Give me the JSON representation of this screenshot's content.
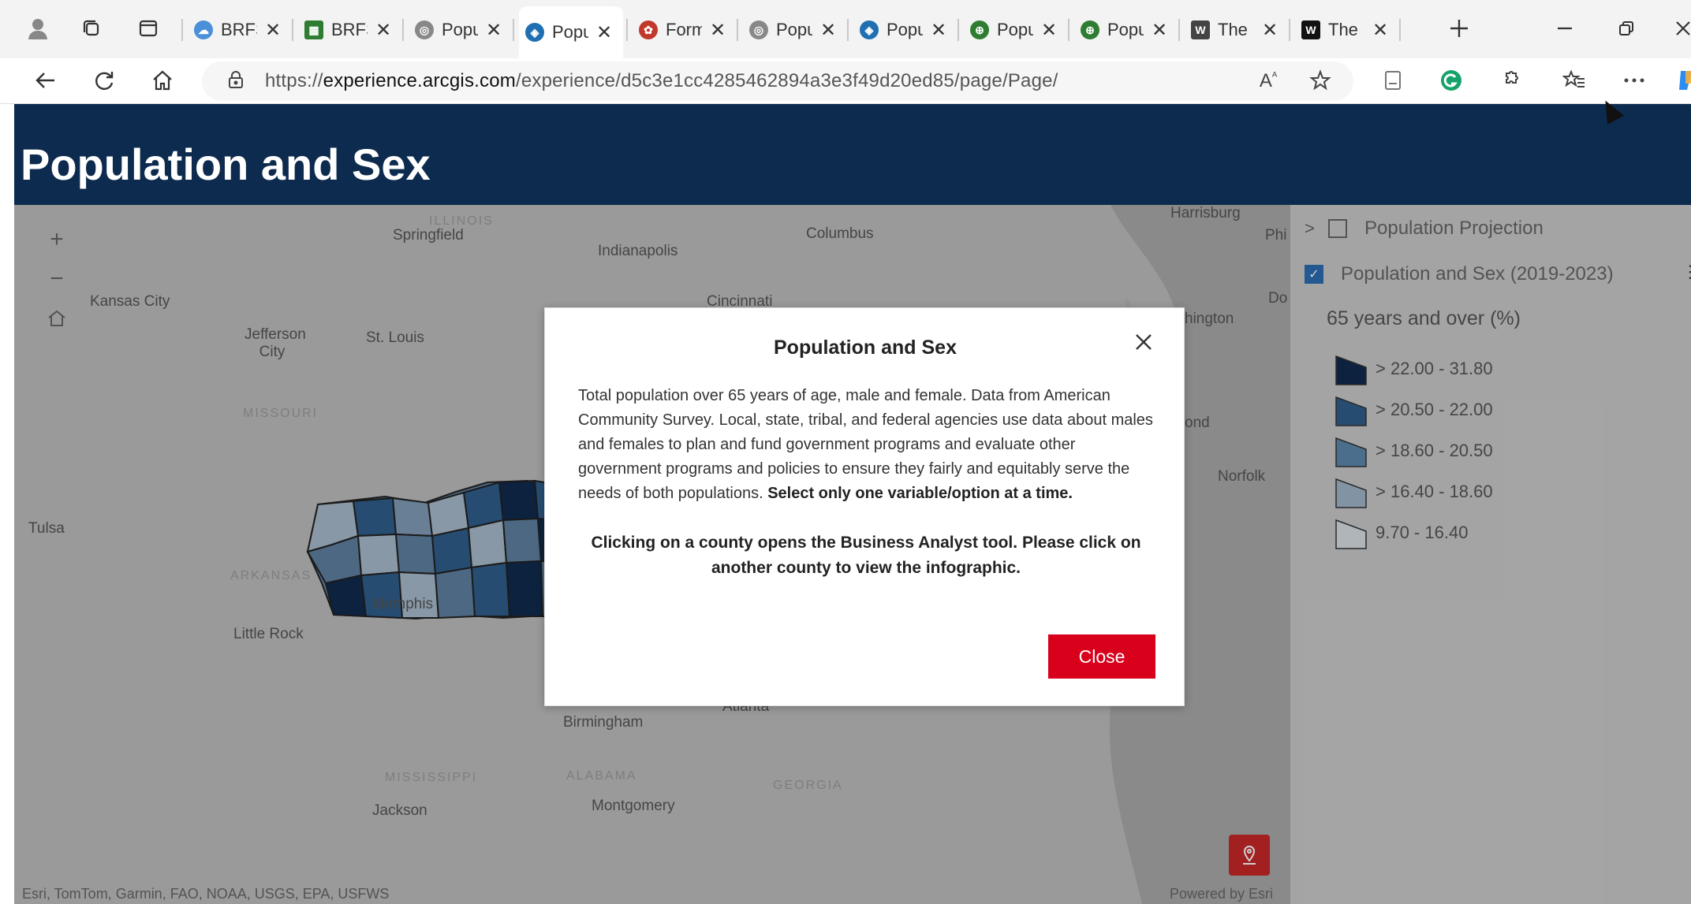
{
  "browser": {
    "tabs": [
      {
        "title": "BRFS",
        "favicon": "cloud-icon",
        "color": "#4a90d9"
      },
      {
        "title": "BRFS",
        "favicon": "sheet-icon",
        "color": "#2e7d32"
      },
      {
        "title": "Popu",
        "favicon": "globe-icon",
        "color": "#888888"
      },
      {
        "title": "Popu",
        "favicon": "arcgis-icon",
        "color": "#1f6fb2",
        "active": true
      },
      {
        "title": "Form",
        "favicon": "form-icon",
        "color": "#c0392b"
      },
      {
        "title": "Popu",
        "favicon": "globe-icon",
        "color": "#888888"
      },
      {
        "title": "Popu",
        "favicon": "arcgis-icon",
        "color": "#1f6fb2"
      },
      {
        "title": "Popu",
        "favicon": "earth-icon",
        "color": "#2e7d32"
      },
      {
        "title": "Popu",
        "favicon": "earth-icon",
        "color": "#2e7d32"
      },
      {
        "title": "The",
        "favicon": "w-icon",
        "color": "#444444"
      },
      {
        "title": "The",
        "favicon": "w-icon",
        "color": "#111111"
      }
    ],
    "url_prefix": "https://",
    "url_host": "experience.arcgis.com",
    "url_path": "/experience/d5c3e1cc4285462894a3e3f49d20ed85/page/Page/"
  },
  "app": {
    "title": "Population and Sex"
  },
  "map": {
    "cities": {
      "springfield": "Springfield",
      "indianapolis": "Indianapolis",
      "columbus": "Columbus",
      "harrisburg": "Harrisburg",
      "phi": "Phi",
      "kansas_city": "Kansas City",
      "jefferson_city_1": "Jefferson",
      "jefferson_city_2": "City",
      "st_louis": "St. Louis",
      "cincinnati": "Cincinnati",
      "do": "Do",
      "hington": "hington",
      "ond": "ond",
      "norfolk": "Norfolk",
      "tulsa": "Tulsa",
      "memphis": "Memphis",
      "little_rock": "Little Rock",
      "birmingham": "Birmingham",
      "atlanta": "Atlanta",
      "jackson": "Jackson",
      "montgomery": "Montgomery"
    },
    "states": {
      "illinois": "ILLINOIS",
      "missouri": "MISSOURI",
      "arkansas": "ARKANSAS",
      "mississippi": "MISSISSIPPI",
      "alabama": "ALABAMA",
      "georgia": "GEORGIA"
    },
    "attribution": "Esri, TomTom, Garmin, FAO, NOAA, USGS, EPA, USFWS",
    "powered_by": "Powered by Esri"
  },
  "layers": {
    "projection_label": "Population Projection",
    "sex_label": "Population and Sex (2019-2023)",
    "legend_title": "65 years and over (%)",
    "legend": [
      {
        "label": "> 22.00 - 31.80",
        "color": "#0f2a4d"
      },
      {
        "label": "> 20.50 - 22.00",
        "color": "#2f5f8a"
      },
      {
        "label": "> 18.60 - 20.50",
        "color": "#5b87ab"
      },
      {
        "label": "> 16.40 - 18.60",
        "color": "#9fb5c8"
      },
      {
        "label": "9.70 - 16.40",
        "color": "#d7dde3"
      }
    ]
  },
  "modal": {
    "title": "Population and Sex",
    "body": "Total population over 65 years of age, male and female. Data from American Community Survey. Local, state, tribal, and federal agencies use data about males and females to plan and fund government programs and evaluate other government programs and policies to ensure they fairly and equitably serve the needs of both populations.",
    "body_emphasis": "Select only one variable/option at a time.",
    "note": "Clicking on a county opens the Business Analyst tool. Please click on another county to view the infographic.",
    "close_label": "Close"
  }
}
